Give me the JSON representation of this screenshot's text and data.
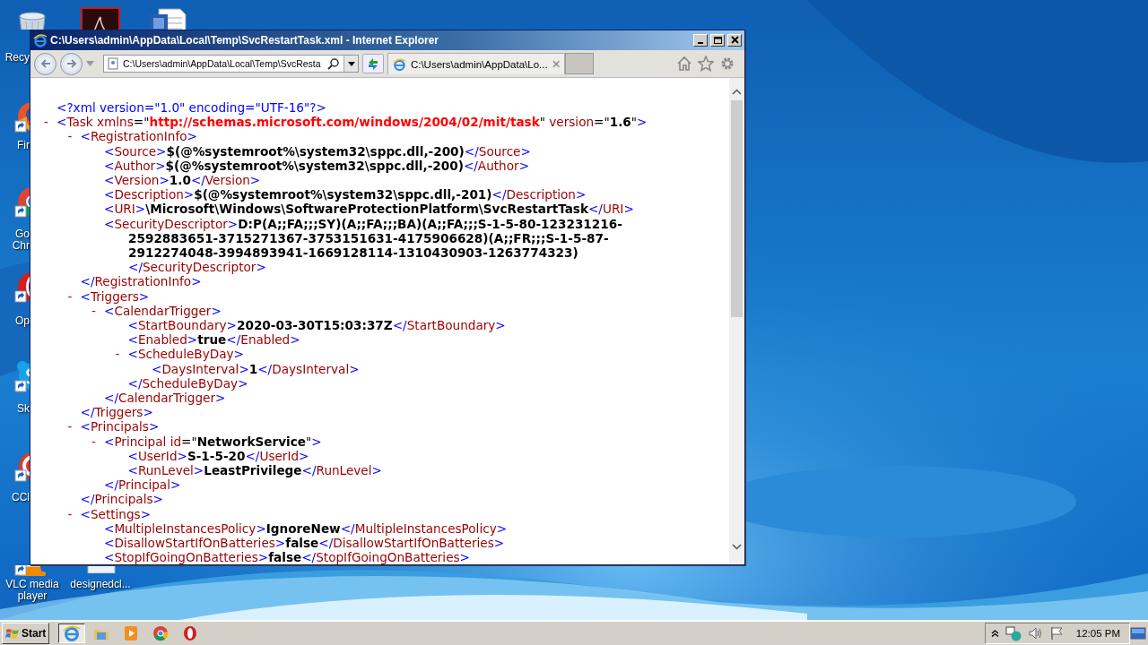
{
  "desktop": {
    "icons": [
      {
        "label": "Recy"
      },
      {
        "label": "Fir"
      },
      {
        "label": "Go Chr"
      },
      {
        "label": "Op"
      },
      {
        "label": "Sk"
      },
      {
        "label": "CCl"
      },
      {
        "label": "VLC media player"
      },
      {
        "label": "designedcl..."
      }
    ]
  },
  "window": {
    "title": "C:\\Users\\admin\\AppData\\Local\\Temp\\SvcRestartTask.xml - Internet Explorer",
    "address": "C:\\Users\\admin\\AppData\\Local\\Temp\\SvcResta",
    "tabs": [
      {
        "label": "C:\\Users\\admin\\AppData\\Lo...",
        "selected": true
      }
    ],
    "xml": [
      {
        "parts": [
          {
            "kind": "pi",
            "text": "<?xml version=\"1.0\" encoding=\"UTF-16\"?>"
          }
        ]
      },
      {
        "toggle": "-",
        "parts": [
          {
            "kind": "p",
            "text": "<"
          },
          {
            "kind": "n",
            "text": "Task xmlns"
          },
          {
            "kind": "q",
            "text": "=\""
          },
          {
            "kind": "u",
            "text": "http://schemas.microsoft.com/windows/2004/02/mit/task"
          },
          {
            "kind": "q",
            "text": "\""
          },
          {
            "kind": "n",
            "text": " version"
          },
          {
            "kind": "q",
            "text": "=\""
          },
          {
            "kind": "v",
            "text": "1.6"
          },
          {
            "kind": "q",
            "text": "\""
          },
          {
            "kind": "p",
            "text": ">"
          }
        ],
        "children": [
          {
            "toggle": "-",
            "parts": [
              {
                "kind": "p",
                "text": "<"
              },
              {
                "kind": "n",
                "text": "RegistrationInfo"
              },
              {
                "kind": "p",
                "text": ">"
              }
            ],
            "children": [
              {
                "parts": [
                  {
                    "kind": "p",
                    "text": "<"
                  },
                  {
                    "kind": "n",
                    "text": "Source"
                  },
                  {
                    "kind": "p",
                    "text": ">"
                  },
                  {
                    "kind": "v",
                    "text": "$(@%systemroot%\\system32\\sppc.dll,-200)"
                  },
                  {
                    "kind": "p",
                    "text": "</"
                  },
                  {
                    "kind": "n",
                    "text": "Source"
                  },
                  {
                    "kind": "p",
                    "text": ">"
                  }
                ]
              },
              {
                "parts": [
                  {
                    "kind": "p",
                    "text": "<"
                  },
                  {
                    "kind": "n",
                    "text": "Author"
                  },
                  {
                    "kind": "p",
                    "text": ">"
                  },
                  {
                    "kind": "v",
                    "text": "$(@%systemroot%\\system32\\sppc.dll,-200)"
                  },
                  {
                    "kind": "p",
                    "text": "</"
                  },
                  {
                    "kind": "n",
                    "text": "Author"
                  },
                  {
                    "kind": "p",
                    "text": ">"
                  }
                ]
              },
              {
                "parts": [
                  {
                    "kind": "p",
                    "text": "<"
                  },
                  {
                    "kind": "n",
                    "text": "Version"
                  },
                  {
                    "kind": "p",
                    "text": ">"
                  },
                  {
                    "kind": "v",
                    "text": "1.0"
                  },
                  {
                    "kind": "p",
                    "text": "</"
                  },
                  {
                    "kind": "n",
                    "text": "Version"
                  },
                  {
                    "kind": "p",
                    "text": ">"
                  }
                ]
              },
              {
                "parts": [
                  {
                    "kind": "p",
                    "text": "<"
                  },
                  {
                    "kind": "n",
                    "text": "Description"
                  },
                  {
                    "kind": "p",
                    "text": ">"
                  },
                  {
                    "kind": "v",
                    "text": "$(@%systemroot%\\system32\\sppc.dll,-201)"
                  },
                  {
                    "kind": "p",
                    "text": "</"
                  },
                  {
                    "kind": "n",
                    "text": "Description"
                  },
                  {
                    "kind": "p",
                    "text": ">"
                  }
                ]
              },
              {
                "parts": [
                  {
                    "kind": "p",
                    "text": "<"
                  },
                  {
                    "kind": "n",
                    "text": "URI"
                  },
                  {
                    "kind": "p",
                    "text": ">"
                  },
                  {
                    "kind": "v",
                    "text": "\\Microsoft\\Windows\\SoftwareProtectionPlatform\\SvcRestartTask"
                  },
                  {
                    "kind": "p",
                    "text": "</"
                  },
                  {
                    "kind": "n",
                    "text": "URI"
                  },
                  {
                    "kind": "p",
                    "text": ">"
                  }
                ]
              },
              {
                "parts": [
                  {
                    "kind": "p",
                    "text": "<"
                  },
                  {
                    "kind": "n",
                    "text": "SecurityDescriptor"
                  },
                  {
                    "kind": "p",
                    "text": ">"
                  },
                  {
                    "kind": "v",
                    "text": "D:P(A;;FA;;;SY)(A;;FA;;;BA)(A;;FA;;;S-1-5-80-123231216-2592883651-3715271367-3753151631-4175906628)(A;;FR;;;S-1-5-87-2912274048-3994893941-1669128114-1310430903-1263774323)"
                  }
                ],
                "close": [
                  {
                    "kind": "p",
                    "text": "</"
                  },
                  {
                    "kind": "n",
                    "text": "SecurityDescriptor"
                  },
                  {
                    "kind": "p",
                    "text": ">"
                  }
                ]
              }
            ],
            "close": [
              {
                "kind": "p",
                "text": "</"
              },
              {
                "kind": "n",
                "text": "RegistrationInfo"
              },
              {
                "kind": "p",
                "text": ">"
              }
            ]
          },
          {
            "toggle": "-",
            "parts": [
              {
                "kind": "p",
                "text": "<"
              },
              {
                "kind": "n",
                "text": "Triggers"
              },
              {
                "kind": "p",
                "text": ">"
              }
            ],
            "children": [
              {
                "toggle": "-",
                "parts": [
                  {
                    "kind": "p",
                    "text": "<"
                  },
                  {
                    "kind": "n",
                    "text": "CalendarTrigger"
                  },
                  {
                    "kind": "p",
                    "text": ">"
                  }
                ],
                "children": [
                  {
                    "parts": [
                      {
                        "kind": "p",
                        "text": "<"
                      },
                      {
                        "kind": "n",
                        "text": "StartBoundary"
                      },
                      {
                        "kind": "p",
                        "text": ">"
                      },
                      {
                        "kind": "v",
                        "text": "2020-03-30T15:03:37Z"
                      },
                      {
                        "kind": "p",
                        "text": "</"
                      },
                      {
                        "kind": "n",
                        "text": "StartBoundary"
                      },
                      {
                        "kind": "p",
                        "text": ">"
                      }
                    ]
                  },
                  {
                    "parts": [
                      {
                        "kind": "p",
                        "text": "<"
                      },
                      {
                        "kind": "n",
                        "text": "Enabled"
                      },
                      {
                        "kind": "p",
                        "text": ">"
                      },
                      {
                        "kind": "v",
                        "text": "true"
                      },
                      {
                        "kind": "p",
                        "text": "</"
                      },
                      {
                        "kind": "n",
                        "text": "Enabled"
                      },
                      {
                        "kind": "p",
                        "text": ">"
                      }
                    ]
                  },
                  {
                    "toggle": "-",
                    "parts": [
                      {
                        "kind": "p",
                        "text": "<"
                      },
                      {
                        "kind": "n",
                        "text": "ScheduleByDay"
                      },
                      {
                        "kind": "p",
                        "text": ">"
                      }
                    ],
                    "children": [
                      {
                        "parts": [
                          {
                            "kind": "p",
                            "text": "<"
                          },
                          {
                            "kind": "n",
                            "text": "DaysInterval"
                          },
                          {
                            "kind": "p",
                            "text": ">"
                          },
                          {
                            "kind": "v",
                            "text": "1"
                          },
                          {
                            "kind": "p",
                            "text": "</"
                          },
                          {
                            "kind": "n",
                            "text": "DaysInterval"
                          },
                          {
                            "kind": "p",
                            "text": ">"
                          }
                        ]
                      }
                    ],
                    "close": [
                      {
                        "kind": "p",
                        "text": "</"
                      },
                      {
                        "kind": "n",
                        "text": "ScheduleByDay"
                      },
                      {
                        "kind": "p",
                        "text": ">"
                      }
                    ]
                  }
                ],
                "close": [
                  {
                    "kind": "p",
                    "text": "</"
                  },
                  {
                    "kind": "n",
                    "text": "CalendarTrigger"
                  },
                  {
                    "kind": "p",
                    "text": ">"
                  }
                ]
              }
            ],
            "close": [
              {
                "kind": "p",
                "text": "</"
              },
              {
                "kind": "n",
                "text": "Triggers"
              },
              {
                "kind": "p",
                "text": ">"
              }
            ]
          },
          {
            "toggle": "-",
            "parts": [
              {
                "kind": "p",
                "text": "<"
              },
              {
                "kind": "n",
                "text": "Principals"
              },
              {
                "kind": "p",
                "text": ">"
              }
            ],
            "children": [
              {
                "toggle": "-",
                "parts": [
                  {
                    "kind": "p",
                    "text": "<"
                  },
                  {
                    "kind": "n",
                    "text": "Principal id"
                  },
                  {
                    "kind": "q",
                    "text": "=\""
                  },
                  {
                    "kind": "v",
                    "text": "NetworkService"
                  },
                  {
                    "kind": "q",
                    "text": "\""
                  },
                  {
                    "kind": "p",
                    "text": ">"
                  }
                ],
                "children": [
                  {
                    "parts": [
                      {
                        "kind": "p",
                        "text": "<"
                      },
                      {
                        "kind": "n",
                        "text": "UserId"
                      },
                      {
                        "kind": "p",
                        "text": ">"
                      },
                      {
                        "kind": "v",
                        "text": "S-1-5-20"
                      },
                      {
                        "kind": "p",
                        "text": "</"
                      },
                      {
                        "kind": "n",
                        "text": "UserId"
                      },
                      {
                        "kind": "p",
                        "text": ">"
                      }
                    ]
                  },
                  {
                    "parts": [
                      {
                        "kind": "p",
                        "text": "<"
                      },
                      {
                        "kind": "n",
                        "text": "RunLevel"
                      },
                      {
                        "kind": "p",
                        "text": ">"
                      },
                      {
                        "kind": "v",
                        "text": "LeastPrivilege"
                      },
                      {
                        "kind": "p",
                        "text": "</"
                      },
                      {
                        "kind": "n",
                        "text": "RunLevel"
                      },
                      {
                        "kind": "p",
                        "text": ">"
                      }
                    ]
                  }
                ],
                "close": [
                  {
                    "kind": "p",
                    "text": "</"
                  },
                  {
                    "kind": "n",
                    "text": "Principal"
                  },
                  {
                    "kind": "p",
                    "text": ">"
                  }
                ]
              }
            ],
            "close": [
              {
                "kind": "p",
                "text": "</"
              },
              {
                "kind": "n",
                "text": "Principals"
              },
              {
                "kind": "p",
                "text": ">"
              }
            ]
          },
          {
            "toggle": "-",
            "parts": [
              {
                "kind": "p",
                "text": "<"
              },
              {
                "kind": "n",
                "text": "Settings"
              },
              {
                "kind": "p",
                "text": ">"
              }
            ],
            "children": [
              {
                "parts": [
                  {
                    "kind": "p",
                    "text": "<"
                  },
                  {
                    "kind": "n",
                    "text": "MultipleInstancesPolicy"
                  },
                  {
                    "kind": "p",
                    "text": ">"
                  },
                  {
                    "kind": "v",
                    "text": "IgnoreNew"
                  },
                  {
                    "kind": "p",
                    "text": "</"
                  },
                  {
                    "kind": "n",
                    "text": "MultipleInstancesPolicy"
                  },
                  {
                    "kind": "p",
                    "text": ">"
                  }
                ]
              },
              {
                "parts": [
                  {
                    "kind": "p",
                    "text": "<"
                  },
                  {
                    "kind": "n",
                    "text": "DisallowStartIfOnBatteries"
                  },
                  {
                    "kind": "p",
                    "text": ">"
                  },
                  {
                    "kind": "v",
                    "text": "false"
                  },
                  {
                    "kind": "p",
                    "text": "</"
                  },
                  {
                    "kind": "n",
                    "text": "DisallowStartIfOnBatteries"
                  },
                  {
                    "kind": "p",
                    "text": ">"
                  }
                ]
              },
              {
                "parts": [
                  {
                    "kind": "p",
                    "text": "<"
                  },
                  {
                    "kind": "n",
                    "text": "StopIfGoingOnBatteries"
                  },
                  {
                    "kind": "p",
                    "text": ">"
                  },
                  {
                    "kind": "v",
                    "text": "false"
                  },
                  {
                    "kind": "p",
                    "text": "</"
                  },
                  {
                    "kind": "n",
                    "text": "StopIfGoingOnBatteries"
                  },
                  {
                    "kind": "p",
                    "text": ">"
                  }
                ]
              }
            ]
          }
        ]
      }
    ]
  },
  "taskbar": {
    "start": "Start",
    "apps": [
      {
        "selected": true
      },
      {
        "selected": false
      },
      {
        "selected": false
      },
      {
        "selected": false
      },
      {
        "selected": false
      }
    ],
    "clock": "12:05 PM"
  }
}
